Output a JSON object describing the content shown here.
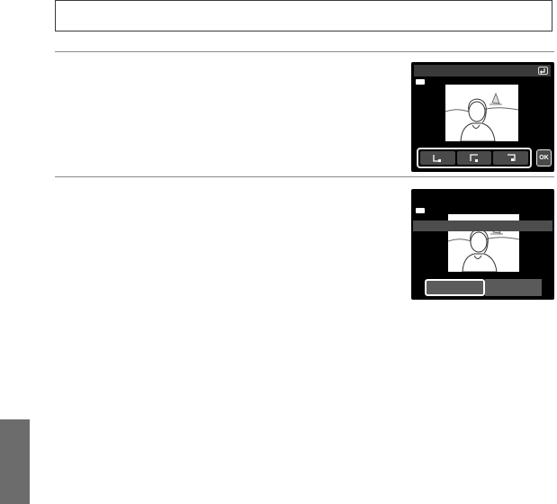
{
  "screen1": {
    "back_icon": "return-icon",
    "battery_icon": "battery-icon",
    "rotate_buttons": [
      {
        "icon": "rotate-left-icon"
      },
      {
        "icon": "rotate-right-icon"
      },
      {
        "icon": "rotate-upside-icon"
      }
    ],
    "ok_label": "OK"
  },
  "screen2": {
    "battery_icon": "battery-icon",
    "choices": [
      {
        "selected": true
      },
      {
        "selected": false
      }
    ]
  }
}
